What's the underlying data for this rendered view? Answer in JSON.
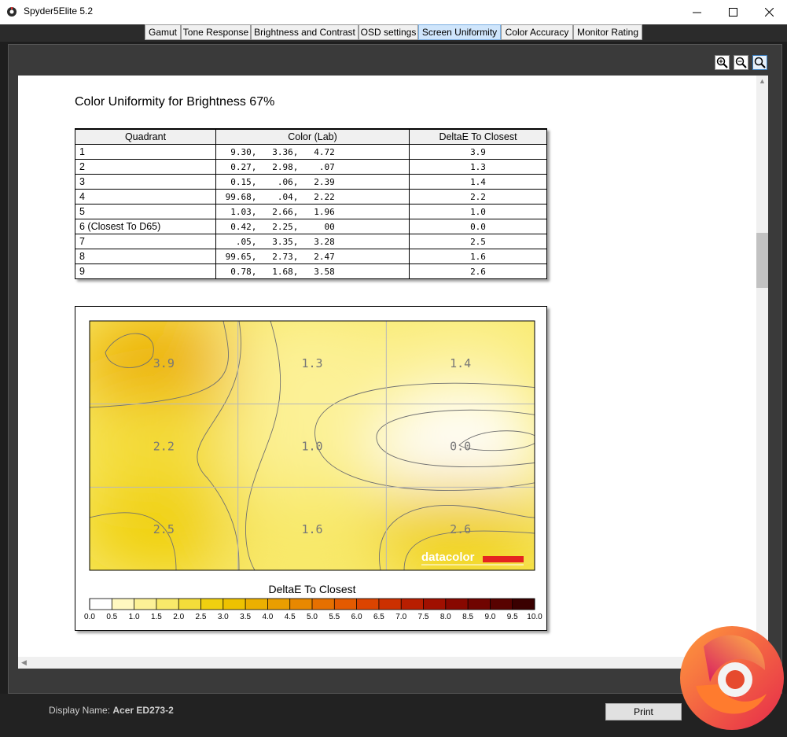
{
  "window": {
    "title": "Spyder5Elite 5.2"
  },
  "tabs": [
    {
      "label": "Gamut"
    },
    {
      "label": "Tone Response"
    },
    {
      "label": "Brightness and Contrast"
    },
    {
      "label": "OSD settings"
    },
    {
      "label": "Screen Uniformity",
      "active": true
    },
    {
      "label": "Color Accuracy"
    },
    {
      "label": "Monitor Rating"
    }
  ],
  "report": {
    "heading": "Color Uniformity for Brightness 67%",
    "table": {
      "headers": [
        "Quadrant",
        "Color (Lab)",
        "DeltaE To Closest"
      ],
      "rows": [
        {
          "quadrant": "1",
          "lab": "  9.30,   3.36,   4.72",
          "delta": "3.9"
        },
        {
          "quadrant": "2",
          "lab": "  0.27,   2.98,    .07",
          "delta": "1.3"
        },
        {
          "quadrant": "3",
          "lab": "  0.15,    .06,   2.39",
          "delta": "1.4"
        },
        {
          "quadrant": "4",
          "lab": " 99.68,    .04,   2.22",
          "delta": "2.2"
        },
        {
          "quadrant": "5",
          "lab": "  1.03,   2.66,   1.96",
          "delta": "1.0"
        },
        {
          "quadrant": "6 (Closest To D65)",
          "lab": "  0.42,   2.25,     00",
          "delta": "0.0"
        },
        {
          "quadrant": "7",
          "lab": "   .05,   3.35,   3.28",
          "delta": "2.5"
        },
        {
          "quadrant": "8",
          "lab": " 99.65,   2.73,   2.47",
          "delta": "1.6"
        },
        {
          "quadrant": "9",
          "lab": "  0.78,   1.68,   3.58",
          "delta": "2.6"
        }
      ]
    }
  },
  "chart_data": {
    "type": "heatmap",
    "grid_rows": 3,
    "grid_cols": 3,
    "cells": [
      [
        "3.9",
        "1.3",
        "1.4"
      ],
      [
        "2.2",
        "1.0",
        "0.0"
      ],
      [
        "2.5",
        "1.6",
        "2.6"
      ]
    ],
    "colorbar_label": "DeltaE To Closest",
    "colorbar_ticks": [
      "0.0",
      "0.5",
      "1.0",
      "1.5",
      "2.0",
      "2.5",
      "3.0",
      "3.5",
      "4.0",
      "4.5",
      "5.0",
      "5.5",
      "6.0",
      "6.5",
      "7.0",
      "7.5",
      "8.0",
      "8.5",
      "9.0",
      "9.5",
      "10.0"
    ],
    "colorbar_range": [
      0,
      10
    ],
    "colorbar_colors": [
      "#ffffff",
      "#fff8c0",
      "#fcf196",
      "#f8e96a",
      "#f4dd3a",
      "#f0d010",
      "#eec200",
      "#ecb000",
      "#ea9e00",
      "#e88800",
      "#e67000",
      "#e45a00",
      "#dc4400",
      "#cc3000",
      "#b81e00",
      "#a01000",
      "#880800",
      "#700400",
      "#580200",
      "#3a0000"
    ],
    "watermark": "datacolor"
  },
  "footer": {
    "display_label": "Display Name:",
    "display_value": "Acer ED273-2",
    "print_label": "Print"
  },
  "colors": {
    "accent_tab": "#cfe5fb",
    "watermark_red": "#e52420"
  }
}
